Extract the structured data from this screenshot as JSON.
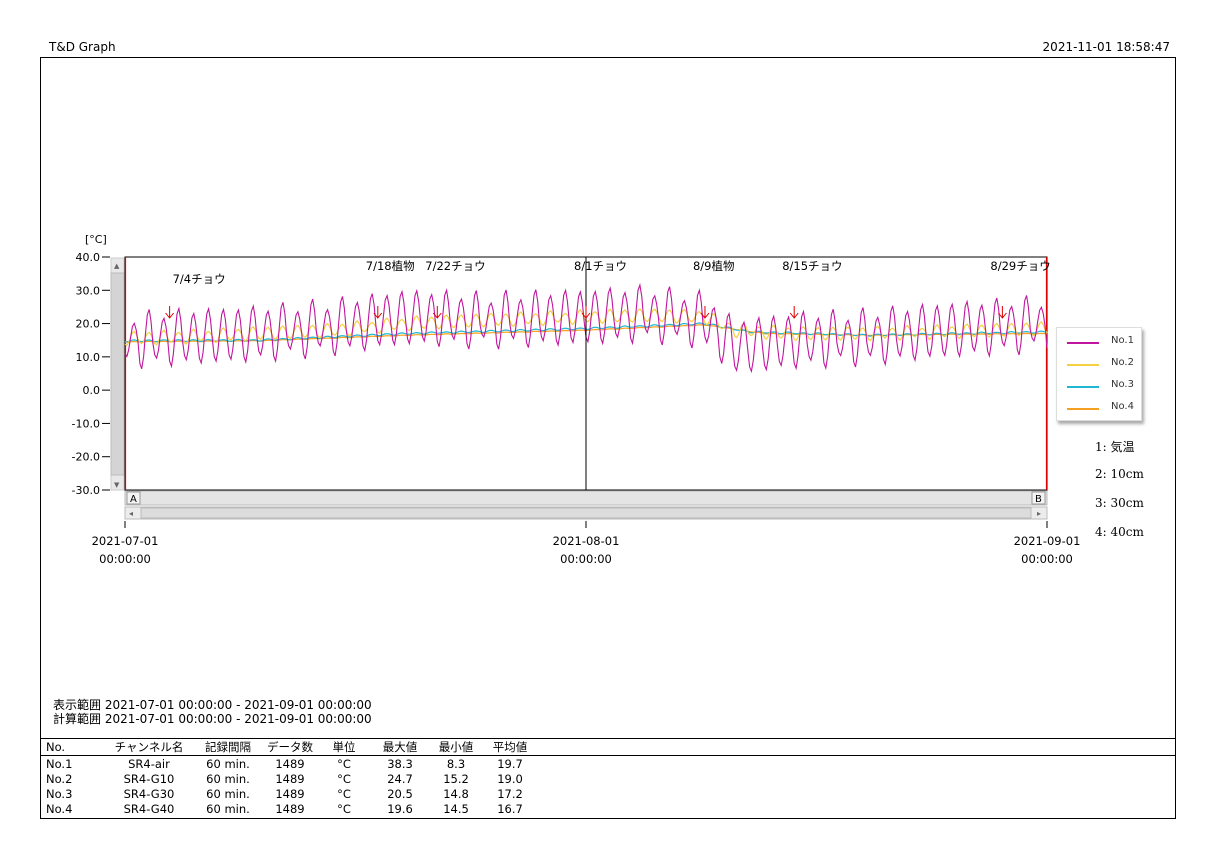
{
  "header": {
    "app_title": "T&D Graph",
    "timestamp": "2021-11-01 18:58:47"
  },
  "chart_data": {
    "type": "line",
    "ylabel": "[°C]",
    "yticks": [
      "40.0",
      "30.0",
      "20.0",
      "10.0",
      "0.0",
      "-10.0",
      "-20.0",
      "-30.0"
    ],
    "ylim": [
      -30,
      40
    ],
    "xlim": [
      "2021-07-01 00:00:00",
      "2021-09-01 00:00:00"
    ],
    "x_ticks": [
      {
        "date": "2021-07-01",
        "time": "00:00:00"
      },
      {
        "date": "2021-08-01",
        "time": "00:00:00"
      },
      {
        "date": "2021-09-01",
        "time": "00:00:00"
      }
    ],
    "cursor_labels": [
      "A",
      "B"
    ],
    "cursor_date": "2021-08-01",
    "annotations": [
      {
        "label": "7/4チョウ",
        "date": "2021-07-04"
      },
      {
        "label": "7/18植物",
        "date": "2021-07-18"
      },
      {
        "label": "7/22チョウ",
        "date": "2021-07-22"
      },
      {
        "label": "8/1チョウ",
        "date": "2021-08-01"
      },
      {
        "label": "8/9植物",
        "date": "2021-08-09"
      },
      {
        "label": "8/15チョウ",
        "date": "2021-08-15"
      },
      {
        "label": "8/29チョウ",
        "date": "2021-08-29"
      }
    ],
    "series": [
      {
        "name": "No.1",
        "color": "#c0169f",
        "points": [
          [
            "2021-07-01",
            15
          ],
          [
            "2021-07-05",
            16
          ],
          [
            "2021-07-10",
            17
          ],
          [
            "2021-07-15",
            19
          ],
          [
            "2021-07-20",
            22
          ],
          [
            "2021-07-25",
            21
          ],
          [
            "2021-08-01",
            22
          ],
          [
            "2021-08-05",
            23
          ],
          [
            "2021-08-09",
            21
          ],
          [
            "2021-08-11",
            13
          ],
          [
            "2021-08-15",
            15
          ],
          [
            "2021-08-20",
            16
          ],
          [
            "2021-08-25",
            18
          ],
          [
            "2021-09-01",
            20
          ]
        ],
        "daily_amplitude": 9
      },
      {
        "name": "No.2",
        "color": "#f5d040",
        "points": [
          [
            "2021-07-01",
            15.5
          ],
          [
            "2021-07-05",
            16
          ],
          [
            "2021-07-10",
            17
          ],
          [
            "2021-07-15",
            18
          ],
          [
            "2021-07-20",
            20
          ],
          [
            "2021-07-25",
            21
          ],
          [
            "2021-08-01",
            22
          ],
          [
            "2021-08-05",
            22.5
          ],
          [
            "2021-08-09",
            22
          ],
          [
            "2021-08-11",
            18
          ],
          [
            "2021-08-15",
            17
          ],
          [
            "2021-08-20",
            17
          ],
          [
            "2021-08-25",
            17.5
          ],
          [
            "2021-09-01",
            18.5
          ]
        ],
        "daily_amplitude": 2.2
      },
      {
        "name": "No.3",
        "color": "#1fb8d0",
        "points": [
          [
            "2021-07-01",
            14.8
          ],
          [
            "2021-07-10",
            15
          ],
          [
            "2021-07-20",
            17
          ],
          [
            "2021-08-01",
            18.5
          ],
          [
            "2021-08-09",
            20
          ],
          [
            "2021-08-12",
            17.5
          ],
          [
            "2021-08-20",
            16.5
          ],
          [
            "2021-09-01",
            17.5
          ]
        ],
        "daily_amplitude": 0.3
      },
      {
        "name": "No.4",
        "color": "#f5a020",
        "points": [
          [
            "2021-07-01",
            14.5
          ],
          [
            "2021-07-10",
            14.8
          ],
          [
            "2021-07-20",
            16.5
          ],
          [
            "2021-08-01",
            18
          ],
          [
            "2021-08-09",
            19.6
          ],
          [
            "2021-08-13",
            17
          ],
          [
            "2021-08-20",
            16.5
          ],
          [
            "2021-09-01",
            17
          ]
        ],
        "daily_amplitude": 0.1
      }
    ]
  },
  "channel_notes": [
    "1: 気温",
    "2: 10cm",
    "3: 30cm",
    "4: 40cm"
  ],
  "ranges": {
    "display": "表示範囲 2021-07-01 00:00:00 - 2021-09-01 00:00:00",
    "calc": "計算範囲 2021-07-01 00:00:00 - 2021-09-01 00:00:00"
  },
  "table": {
    "headers": [
      "No.",
      "チャンネル名",
      "記録間隔",
      "データ数",
      "単位",
      "最大値",
      "最小値",
      "平均値"
    ],
    "rows": [
      [
        "No.1",
        "SR4-air",
        "60 min.",
        "1489",
        "°C",
        "38.3",
        "8.3",
        "19.7"
      ],
      [
        "No.2",
        "SR4-G10",
        "60 min.",
        "1489",
        "°C",
        "24.7",
        "15.2",
        "19.0"
      ],
      [
        "No.3",
        "SR4-G30",
        "60 min.",
        "1489",
        "°C",
        "20.5",
        "14.8",
        "17.2"
      ],
      [
        "No.4",
        "SR4-G40",
        "60 min.",
        "1489",
        "°C",
        "19.6",
        "14.5",
        "16.7"
      ]
    ]
  }
}
